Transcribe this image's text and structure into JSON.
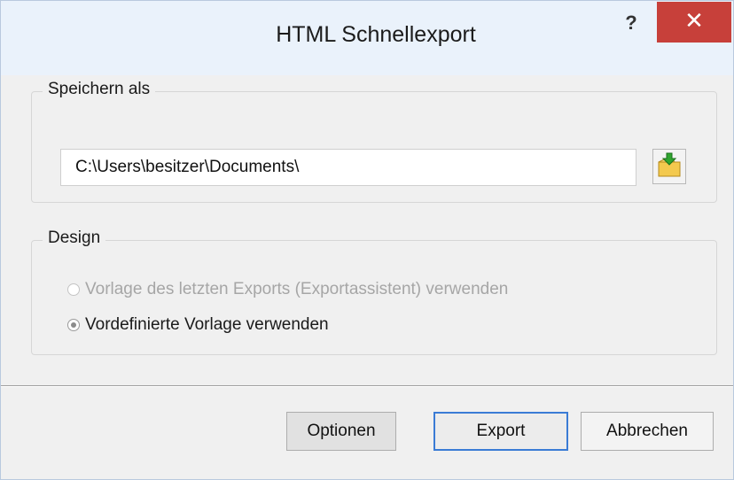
{
  "dialog": {
    "title": "HTML Schnellexport",
    "help_label": "?",
    "close_label": "✕"
  },
  "save_group": {
    "legend": "Speichern als",
    "path_value": "C:\\Users\\besitzer\\Documents\\",
    "browse_icon": "folder-arrow-icon"
  },
  "design_group": {
    "legend": "Design",
    "options": [
      {
        "label": "Vorlage des letzten Exports (Exportassistent) verwenden",
        "selected": false,
        "enabled": false
      },
      {
        "label": "Vordefinierte Vorlage verwenden",
        "selected": true,
        "enabled": true
      }
    ]
  },
  "buttons": {
    "options_label": "Optionen",
    "export_label": "Export",
    "cancel_label": "Abbrechen"
  },
  "colors": {
    "titlebar": "#eaf2fb",
    "close": "#c7403a",
    "accent_border": "#3a7bd5"
  }
}
